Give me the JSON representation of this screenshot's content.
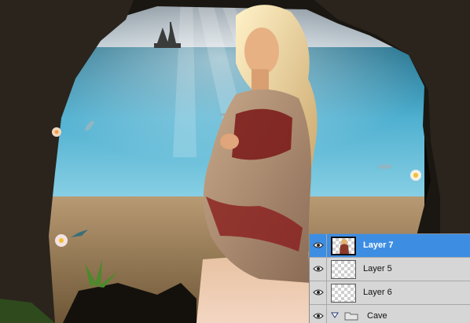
{
  "canvas": {
    "description_icon": "image-canvas"
  },
  "layers_panel": {
    "selected_color": "#3d8ee3",
    "layers": [
      {
        "name": "Layer 7",
        "selected": true,
        "visible": true,
        "thumbnail": "woman-thumbnail"
      },
      {
        "name": "Layer 5",
        "selected": false,
        "visible": true,
        "thumbnail": "transparent-thumbnail"
      },
      {
        "name": "Layer 6",
        "selected": false,
        "visible": true,
        "thumbnail": "transparent-thumbnail"
      }
    ],
    "group": {
      "name": "Cave",
      "visible": true,
      "expanded": false
    }
  }
}
